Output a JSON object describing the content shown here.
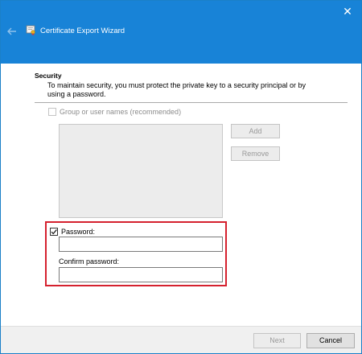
{
  "window": {
    "title": "Certificate Export Wizard",
    "close_glyph": "✕"
  },
  "security": {
    "heading": "Security",
    "description": "To maintain security, you must protect the private key to a security principal or by using a password.",
    "group_checkbox_label": "Group or user names (recommended)",
    "group_checkbox_checked": false,
    "add_button": "Add",
    "remove_button": "Remove",
    "password_checkbox_label": "Password:",
    "password_checkbox_checked": true,
    "password_value": "",
    "confirm_label": "Confirm password:",
    "confirm_value": ""
  },
  "footer": {
    "next_button": "Next",
    "cancel_button": "Cancel"
  },
  "colors": {
    "titlebar": "#1883d7",
    "highlight": "#d5212e"
  }
}
